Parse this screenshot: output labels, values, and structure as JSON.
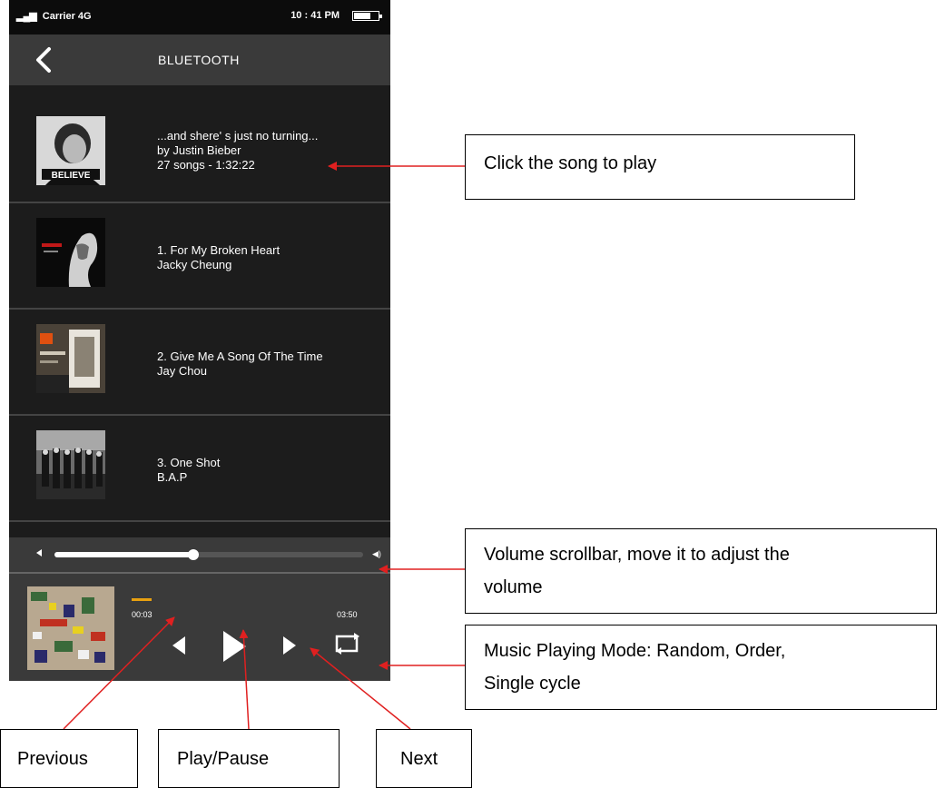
{
  "status_bar": {
    "carrier": "Carrier 4G",
    "time": "10 : 41 PM",
    "signal_icon": "signal-bars-icon",
    "battery_icon": "battery-icon"
  },
  "header": {
    "title": "BLUETOOTH",
    "back_icon": "chevron-left-icon"
  },
  "songs": [
    {
      "line1": "...and shere' s just no turning...",
      "line2": "by Justin Bieber",
      "line3": "27 songs - 1:32:22",
      "art_caption": "BELIEVE"
    },
    {
      "line1": "1. For My Broken Heart",
      "line2": "Jacky Cheung"
    },
    {
      "line1": "2. Give Me A Song Of The Time",
      "line2": "Jay Chou"
    },
    {
      "line1": "3. One Shot",
      "line2": "B.A.P"
    }
  ],
  "volume": {
    "level": 0.45,
    "min_icon": "volume-low-icon",
    "max_icon": "volume-high-icon"
  },
  "player": {
    "elapsed": "00:03",
    "duration": "03:50",
    "progress": 0.013,
    "controls": {
      "previous_icon": "previous-icon",
      "play_icon": "play-icon",
      "next_icon": "next-icon",
      "mode_icon": "repeat-icon"
    }
  },
  "callouts": {
    "song": "Click the song to play",
    "volume_line1": "Volume scrollbar, move it to adjust the",
    "volume_line2": "volume",
    "mode_line1": "Music Playing Mode: Random, Order,",
    "mode_line2": "Single cycle",
    "previous": "Previous",
    "play_pause": "Play/Pause",
    "next": "Next"
  },
  "colors": {
    "background": "#1c1c1c",
    "bar": "#3a3a3a",
    "accent": "#e8a010",
    "arrow": "#e02020"
  }
}
